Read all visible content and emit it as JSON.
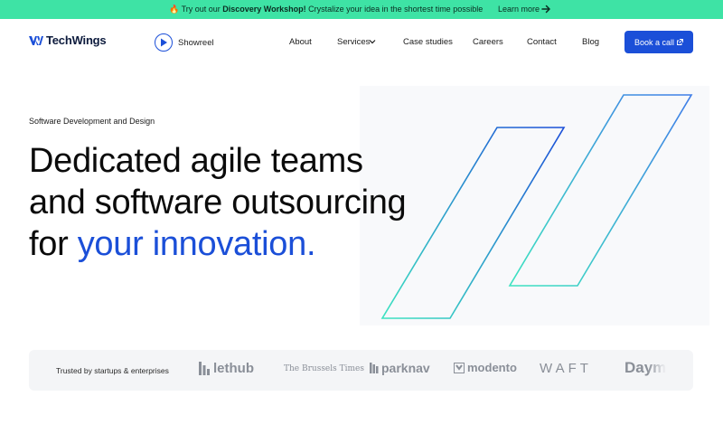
{
  "announcement": {
    "icon": "fire-icon",
    "prefix": "Try out our ",
    "highlight": "Discovery Workshop!",
    "suffix": " Crystalize your idea in the shortest time possible",
    "link_label": "Learn more"
  },
  "nav": {
    "brand": "TechWings",
    "showreel_label": "Showreel",
    "links": [
      {
        "label": "About"
      },
      {
        "label": "Services"
      },
      {
        "label": "Case studies"
      },
      {
        "label": "Careers"
      },
      {
        "label": "Contact"
      },
      {
        "label": "Blog"
      }
    ],
    "cta_label": "Book a call"
  },
  "hero": {
    "eyebrow": "Software Development and Design",
    "headline_line1": "Dedicated agile teams",
    "headline_line2": "and software outsourcing",
    "headline_line3_prefix": "for ",
    "headline_accent": "your innovation."
  },
  "trust": {
    "label": "Trusted by startups & enterprises",
    "brands": [
      "lethub",
      "The Brussels Times",
      "parknav",
      "modento",
      "WAFT",
      "Daym"
    ]
  },
  "colors": {
    "announcement_bg": "#3ee3a5",
    "primary": "#1b4fd8",
    "trust_bg": "#f4f5f7"
  }
}
